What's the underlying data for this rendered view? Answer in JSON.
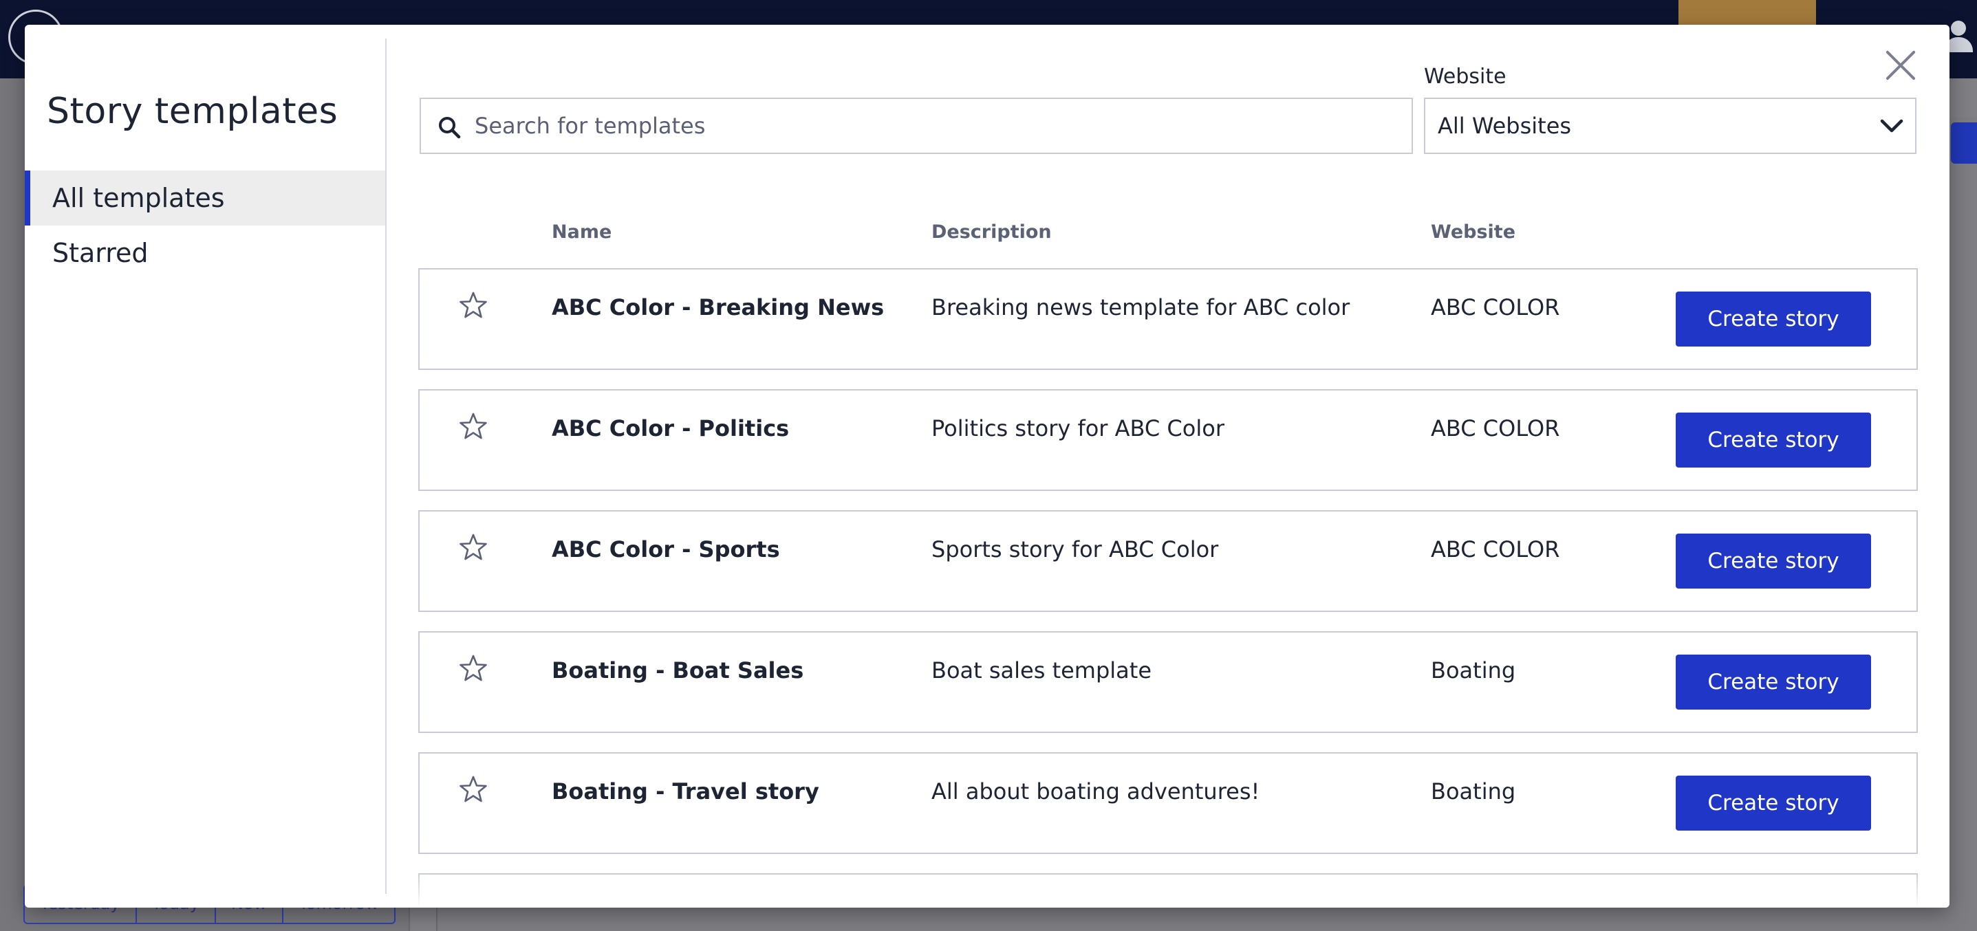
{
  "background": {
    "date_buttons": [
      "Yesterday",
      "Today",
      "Now",
      "Tomorrow"
    ]
  },
  "modal": {
    "title": "Story templates",
    "nav": {
      "all_templates": "All templates",
      "starred": "Starred"
    },
    "search": {
      "placeholder": "Search for templates",
      "value": ""
    },
    "website_filter": {
      "label": "Website",
      "selected": "All Websites"
    },
    "columns": {
      "name": "Name",
      "description": "Description",
      "website": "Website"
    },
    "rows": [
      {
        "name": "ABC Color - Breaking News",
        "description": "Breaking news template for ABC color",
        "website": "ABC COLOR",
        "action": "Create story",
        "starred": false
      },
      {
        "name": "ABC Color - Politics",
        "description": "Politics story for ABC Color",
        "website": "ABC COLOR",
        "action": "Create story",
        "starred": false
      },
      {
        "name": "ABC Color - Sports",
        "description": "Sports story for ABC Color",
        "website": "ABC COLOR",
        "action": "Create story",
        "starred": false
      },
      {
        "name": "Boating - Boat Sales",
        "description": "Boat sales template",
        "website": "Boating",
        "action": "Create story",
        "starred": false
      },
      {
        "name": "Boating - Travel story",
        "description": "All about boating adventures!",
        "website": "Boating",
        "action": "Create story",
        "starred": false
      }
    ],
    "icons": {
      "close": "close-icon",
      "search": "search-icon",
      "dropdown": "chevron-down-icon",
      "star": "star-outline-icon"
    },
    "colors": {
      "accent": "#2036c7",
      "muted_text": "#5b6275",
      "border": "#c9ccd6"
    }
  }
}
